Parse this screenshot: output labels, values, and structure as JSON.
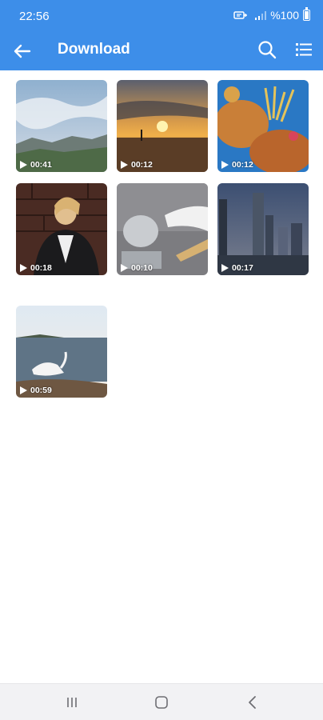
{
  "status_bar": {
    "time": "22:56",
    "battery": "%100",
    "icons": [
      "wifi-calling-icon",
      "signal-icon",
      "battery-icon"
    ]
  },
  "app_bar": {
    "title": "Download",
    "back_icon": "arrow-left-icon",
    "search_icon": "search-icon",
    "menu_icon": "list-view-icon",
    "background": "#3d8ee9"
  },
  "videos": [
    {
      "duration": "00:41",
      "scene": "cloudy sky over hills"
    },
    {
      "duration": "00:12",
      "scene": "sunset on beach"
    },
    {
      "duration": "00:12",
      "scene": "coral reef"
    },
    {
      "duration": "00:18",
      "scene": "woman in leather jacket"
    },
    {
      "duration": "00:10",
      "scene": "cooking pot with steam"
    },
    {
      "duration": "00:17",
      "scene": "city skyline"
    },
    {
      "duration": "00:59",
      "scene": "swan at lake shore"
    }
  ],
  "nav_bar": {
    "icons": [
      "recents-icon",
      "home-icon",
      "back-icon"
    ]
  }
}
